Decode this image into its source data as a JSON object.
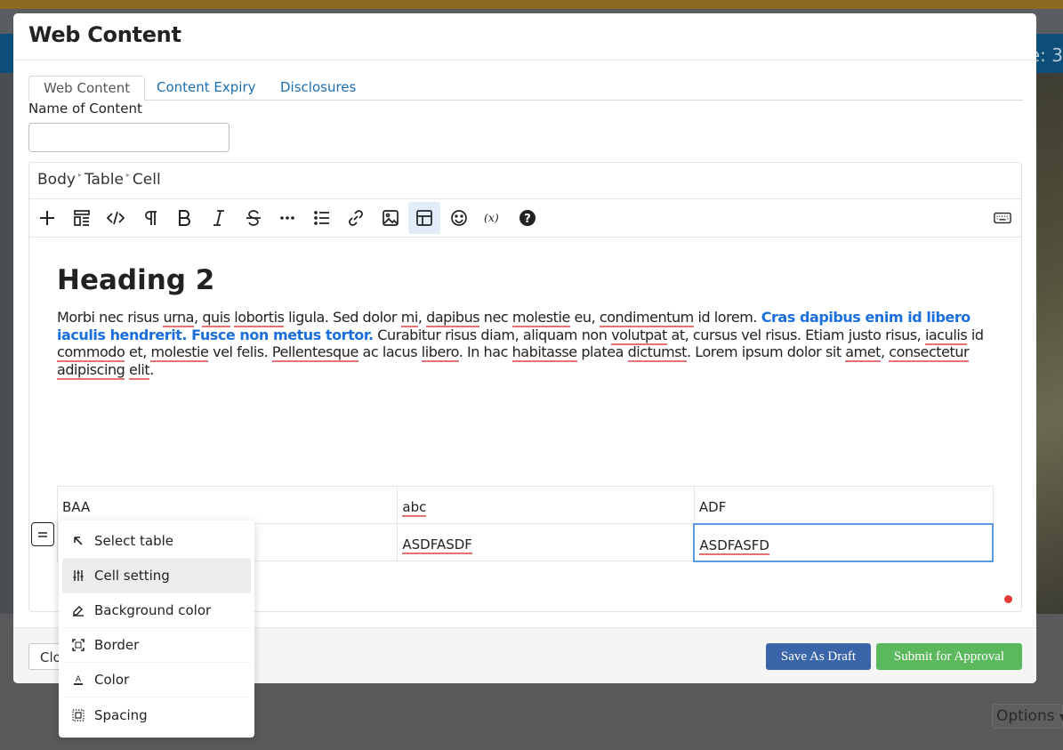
{
  "background": {
    "partial_text": "e: 3",
    "options_select": "Options"
  },
  "modal": {
    "title": "Web Content",
    "tabs": [
      {
        "label": "Web Content",
        "active": true
      },
      {
        "label": "Content Expiry",
        "active": false
      },
      {
        "label": "Disclosures",
        "active": false
      }
    ],
    "name_label": "Name of Content",
    "name_value": ""
  },
  "editor": {
    "breadcrumb": [
      "Body",
      "Table",
      "Cell"
    ],
    "toolbar": [
      {
        "name": "plus-icon"
      },
      {
        "name": "layout-icon"
      },
      {
        "name": "code-icon"
      },
      {
        "name": "paragraph-icon"
      },
      {
        "name": "bold-icon"
      },
      {
        "name": "italic-icon"
      },
      {
        "name": "strikethrough-icon"
      },
      {
        "name": "more-icon"
      },
      {
        "name": "list-icon"
      },
      {
        "name": "link-icon"
      },
      {
        "name": "image-icon"
      },
      {
        "name": "table-icon",
        "active": true
      },
      {
        "name": "emoji-icon"
      },
      {
        "name": "variable-icon"
      },
      {
        "name": "help-icon"
      },
      {
        "name": "keyboard-icon"
      }
    ],
    "heading": "Heading 2",
    "paragraph": {
      "p1": "Morbi nec risus ",
      "w1": "urna",
      "p2": ", ",
      "w2": "quis",
      "p3": " ",
      "w3": "lobortis",
      "p4": " ligula. Sed dolor ",
      "w4": "mi",
      "p5": ", ",
      "w5": "dapibus",
      "p6": " nec ",
      "w6": "molestie",
      "p7": " eu, ",
      "w7": "condimentum",
      "p8": " id lorem. ",
      "bold": "Cras dapibus enim id libero iaculis hendrerit. Fusce non metus tortor.",
      "p9": " Curabitur risus diam, aliquam non ",
      "w8": "volutpat",
      "p10": " at, cursus vel risus. Etiam justo risus, ",
      "w9": "iaculis",
      "p11": " id ",
      "w10": "commodo",
      "p12": " et, ",
      "w11": "molestie",
      "p13": " vel felis. ",
      "w12": "Pellentesque",
      "p14": " ac lacus ",
      "w13": "libero",
      "p15": ". In hac ",
      "w14": "habitasse",
      "p16": " platea ",
      "w15": "dictumst",
      "p17": ". Lorem ipsum dolor sit ",
      "w16": "amet",
      "p18": ", ",
      "w17": "consectetur",
      "p19": " ",
      "w18": "adipiscing",
      "p20": " ",
      "w19": "elit",
      "p21": "."
    },
    "table": {
      "rows": [
        [
          "BAA",
          "abc",
          "ADF"
        ],
        [
          "",
          "ASDFASDF",
          "ASDFASFD"
        ]
      ]
    }
  },
  "cell_menu": {
    "items": [
      {
        "label": "Select table",
        "icon": "arrow-up-left-icon"
      },
      {
        "label": "Cell setting",
        "icon": "sliders-icon",
        "hover": true
      },
      {
        "label": "Background color",
        "icon": "paint-bucket-icon"
      },
      {
        "label": "Border",
        "icon": "border-icon"
      },
      {
        "label": "Color",
        "icon": "text-color-icon"
      },
      {
        "label": "Spacing",
        "icon": "spacing-icon"
      }
    ]
  },
  "footer": {
    "close_label": "Close",
    "close_visible": "Clo",
    "draft_label": "Save As Draft",
    "submit_label": "Submit for Approval"
  },
  "colors": {
    "primary": "#3a65a8",
    "success": "#5cb85c",
    "link": "#1a6fb3",
    "highlight_text": "#1a6fdc",
    "spellcheck": "#e57373"
  }
}
